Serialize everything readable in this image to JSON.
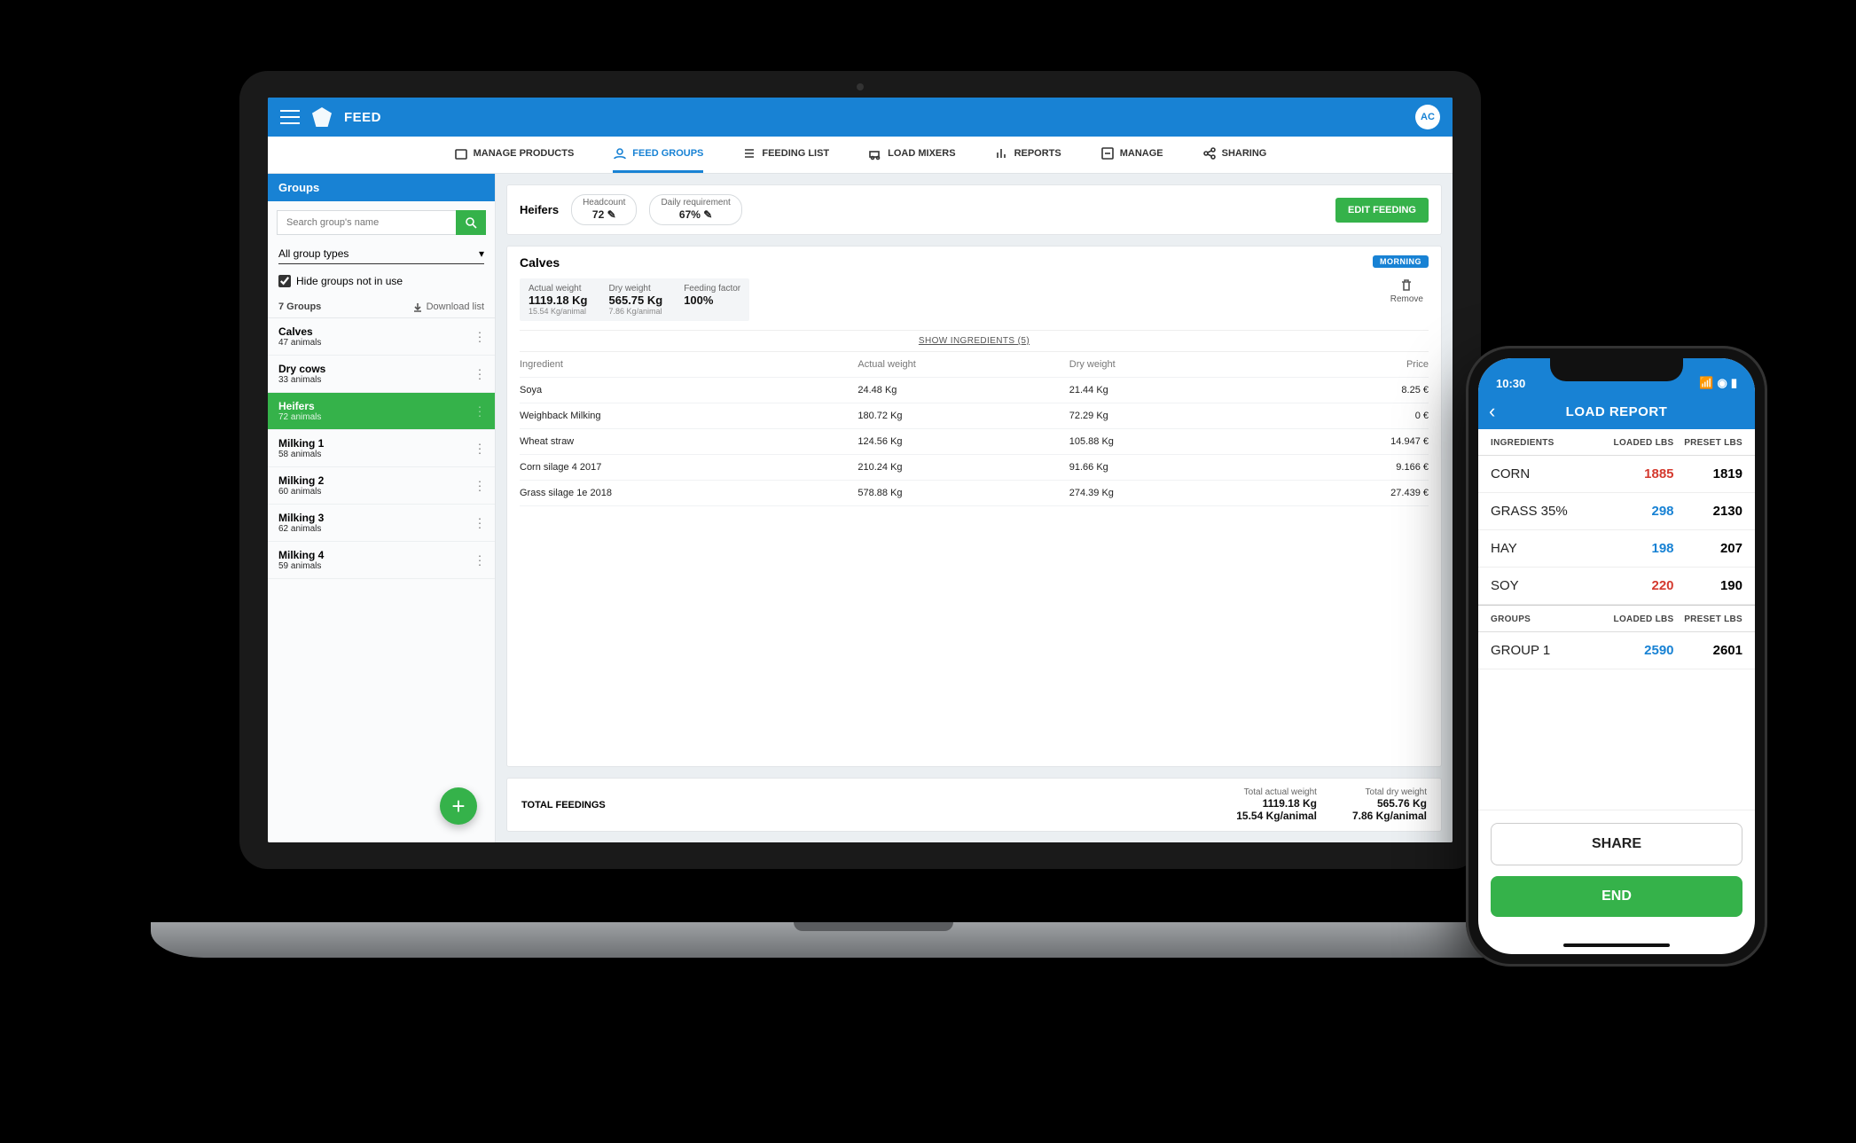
{
  "header": {
    "app_title": "FEED",
    "avatar": "AC"
  },
  "tabs": [
    {
      "label": "MANAGE PRODUCTS"
    },
    {
      "label": "FEED GROUPS"
    },
    {
      "label": "FEEDING LIST"
    },
    {
      "label": "LOAD MIXERS"
    },
    {
      "label": "REPORTS"
    },
    {
      "label": "MANAGE"
    },
    {
      "label": "SHARING"
    }
  ],
  "sidebar": {
    "title": "Groups",
    "search_placeholder": "Search group's name",
    "filter_label": "All group types",
    "hide_label": "Hide groups not in use",
    "count_label": "7 Groups",
    "download_label": "Download list",
    "groups": [
      {
        "name": "Calves",
        "sub": "47 animals"
      },
      {
        "name": "Dry cows",
        "sub": "33 animals"
      },
      {
        "name": "Heifers",
        "sub": "72 animals"
      },
      {
        "name": "Milking 1",
        "sub": "58 animals"
      },
      {
        "name": "Milking 2",
        "sub": "60 animals"
      },
      {
        "name": "Milking 3",
        "sub": "62 animals"
      },
      {
        "name": "Milking 4",
        "sub": "59 animals"
      }
    ]
  },
  "detail": {
    "group_name": "Heifers",
    "headcount_label": "Headcount",
    "headcount_value": "72",
    "daily_label": "Daily requirement",
    "daily_value": "67%",
    "edit_label": "EDIT FEEDING"
  },
  "feeding": {
    "title": "Calves",
    "badge": "MORNING",
    "remove_label": "Remove",
    "stats": {
      "actual_label": "Actual weight",
      "actual_value": "1119.18 Kg",
      "actual_sub": "15.54 Kg/animal",
      "dry_label": "Dry weight",
      "dry_value": "565.75 Kg",
      "dry_sub": "7.86 Kg/animal",
      "factor_label": "Feeding factor",
      "factor_value": "100%"
    },
    "show_label": "SHOW INGREDIENTS (5)",
    "cols": {
      "ingredient": "Ingredient",
      "actual": "Actual weight",
      "dry": "Dry weight",
      "price": "Price"
    },
    "rows": [
      {
        "ingredient": "Soya",
        "actual": "24.48 Kg",
        "dry": "21.44 Kg",
        "price": "8.25 €"
      },
      {
        "ingredient": "Weighback Milking",
        "actual": "180.72 Kg",
        "dry": "72.29 Kg",
        "price": "0 €"
      },
      {
        "ingredient": "Wheat straw",
        "actual": "124.56 Kg",
        "dry": "105.88 Kg",
        "price": "14.947 €"
      },
      {
        "ingredient": "Corn silage 4 2017",
        "actual": "210.24 Kg",
        "dry": "91.66 Kg",
        "price": "9.166 €"
      },
      {
        "ingredient": "Grass silage 1e 2018",
        "actual": "578.88 Kg",
        "dry": "274.39 Kg",
        "price": "27.439 €"
      }
    ]
  },
  "footer": {
    "title": "TOTAL FEEDINGS",
    "actual_label": "Total actual weight",
    "actual_value": "1119.18 Kg",
    "actual_sub": "15.54 Kg/animal",
    "dry_label": "Total dry weight",
    "dry_value": "565.76 Kg",
    "dry_sub": "7.86 Kg/animal"
  },
  "phone": {
    "time": "10:30",
    "nav_title": "LOAD REPORT",
    "head_ing": "INGREDIENTS",
    "head_loaded": "LOADED LBS",
    "head_preset": "PRESET LBS",
    "ingredients": [
      {
        "name": "CORN",
        "loaded": "1885",
        "preset": "1819",
        "color": "red"
      },
      {
        "name": "GRASS 35%",
        "loaded": "298",
        "preset": "2130",
        "color": "blue"
      },
      {
        "name": "HAY",
        "loaded": "198",
        "preset": "207",
        "color": "blue"
      },
      {
        "name": "SOY",
        "loaded": "220",
        "preset": "190",
        "color": "red"
      }
    ],
    "head_groups": "GROUPS",
    "groups": [
      {
        "name": "GROUP 1",
        "loaded": "2590",
        "preset": "2601",
        "color": "blue"
      }
    ],
    "share_label": "SHARE",
    "end_label": "END"
  }
}
